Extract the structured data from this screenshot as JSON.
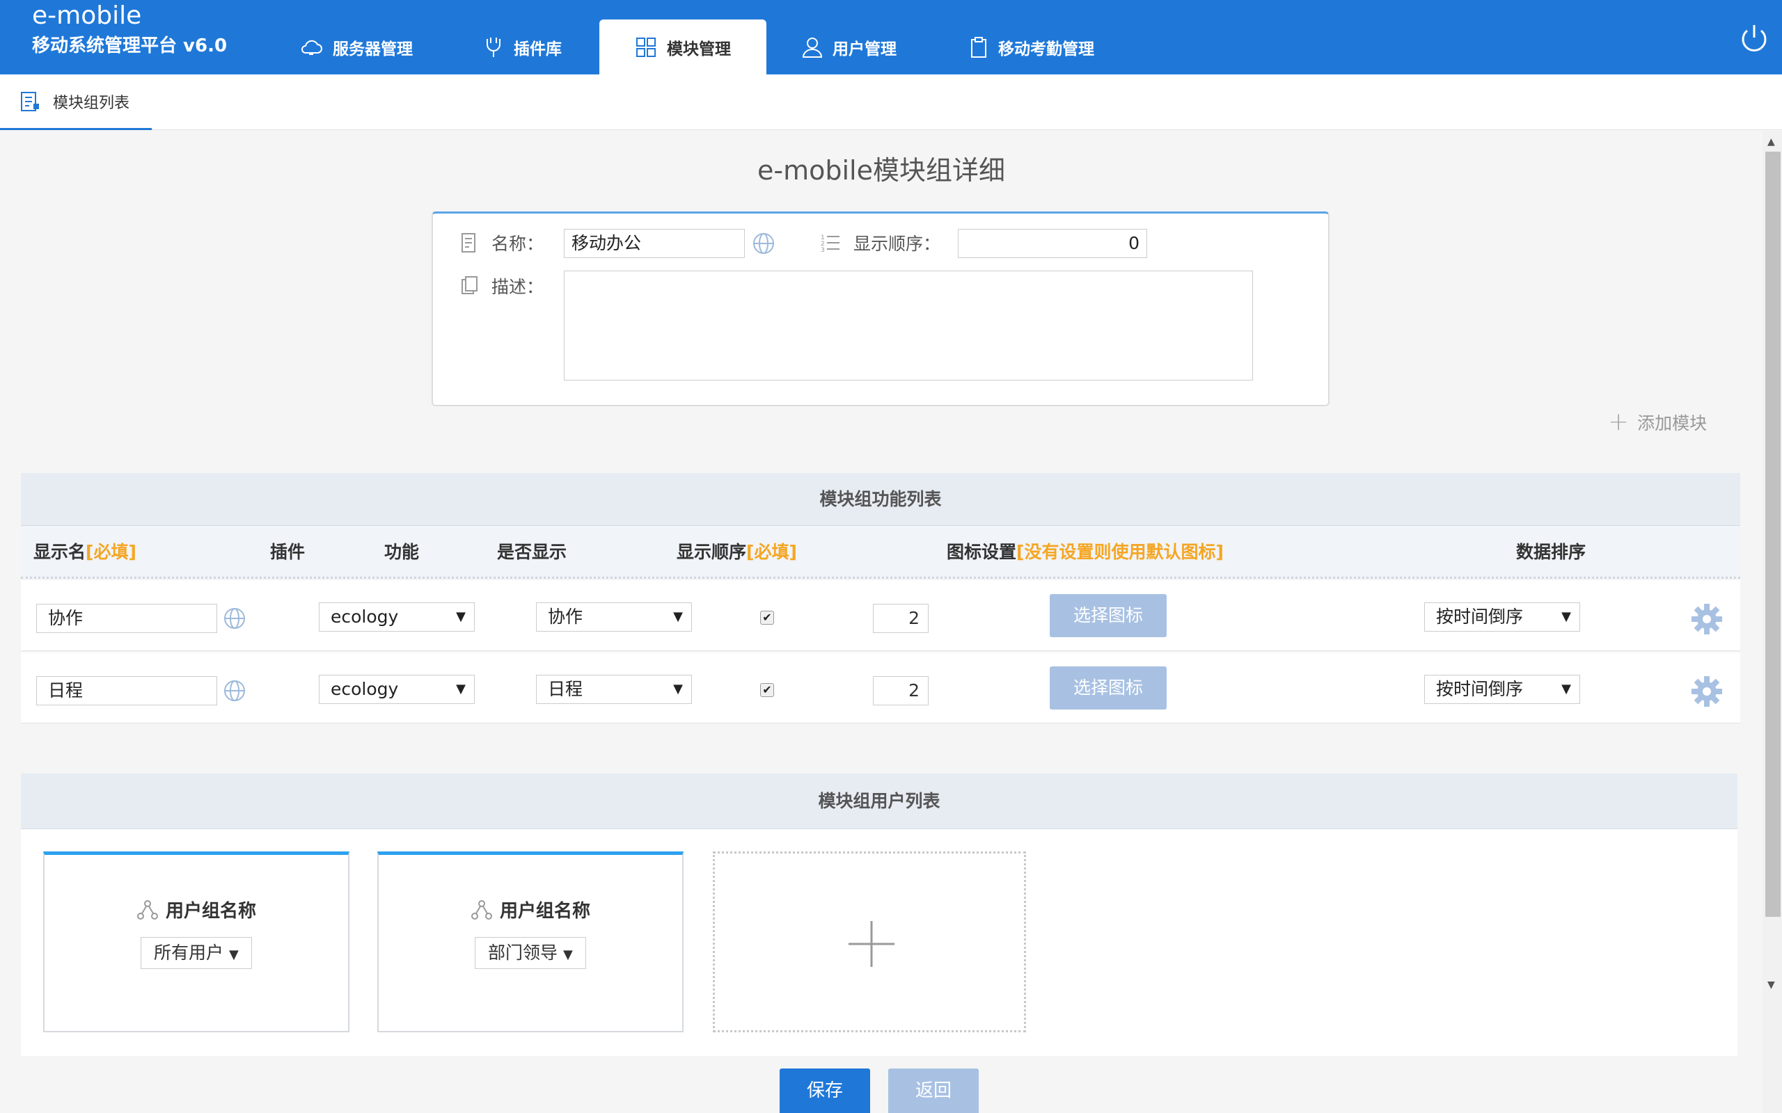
{
  "app": {
    "name": "e-mobile",
    "subtitle": "移动系统管理平台 v6.0"
  },
  "nav": {
    "tabs": [
      {
        "label": "服务器管理",
        "icon": "cloud-icon"
      },
      {
        "label": "插件库",
        "icon": "plug-icon"
      },
      {
        "label": "模块管理",
        "icon": "module-icon",
        "active": true
      },
      {
        "label": "用户管理",
        "icon": "user-icon"
      },
      {
        "label": "移动考勤管理",
        "icon": "clipboard-icon"
      }
    ]
  },
  "subnav": {
    "tab_label": "模块组列表"
  },
  "page": {
    "title": "e-mobile模块组详细"
  },
  "detail": {
    "name_label": "名称：",
    "name_value": "移动办公",
    "order_label": "显示顺序：",
    "order_value": "0",
    "desc_label": "描述：",
    "desc_value": ""
  },
  "add_module_label": "添加模块",
  "func_table": {
    "title": "模块组功能列表",
    "headers": {
      "display_name": "显示名",
      "display_name_req": "[必填]",
      "plugin": "插件",
      "function": "功能",
      "is_shown": "是否显示",
      "order": "显示顺序",
      "order_req": "[必填]",
      "icon_setting": "图标设置",
      "icon_setting_note": "[没有设置则使用默认图标]",
      "sort": "数据排序"
    },
    "rows": [
      {
        "name": "协作",
        "plugin": "ecology",
        "function": "协作",
        "shown": true,
        "order": "2",
        "icon_button": "选择图标",
        "sort": "按时间倒序"
      },
      {
        "name": "日程",
        "plugin": "ecology",
        "function": "日程",
        "shown": true,
        "order": "2",
        "icon_button": "选择图标",
        "sort": "按时间倒序"
      }
    ]
  },
  "user_table": {
    "title": "模块组用户列表",
    "groups": [
      {
        "label": "用户组名称",
        "selected": "所有用户"
      },
      {
        "label": "用户组名称",
        "selected": "部门领导"
      }
    ]
  },
  "buttons": {
    "save": "保存",
    "back": "返回"
  },
  "colors": {
    "header_bg": "#1f78d8",
    "required": "#f5a623",
    "card_top": "#2da1f0",
    "disabled_btn": "#a8c1e3"
  }
}
